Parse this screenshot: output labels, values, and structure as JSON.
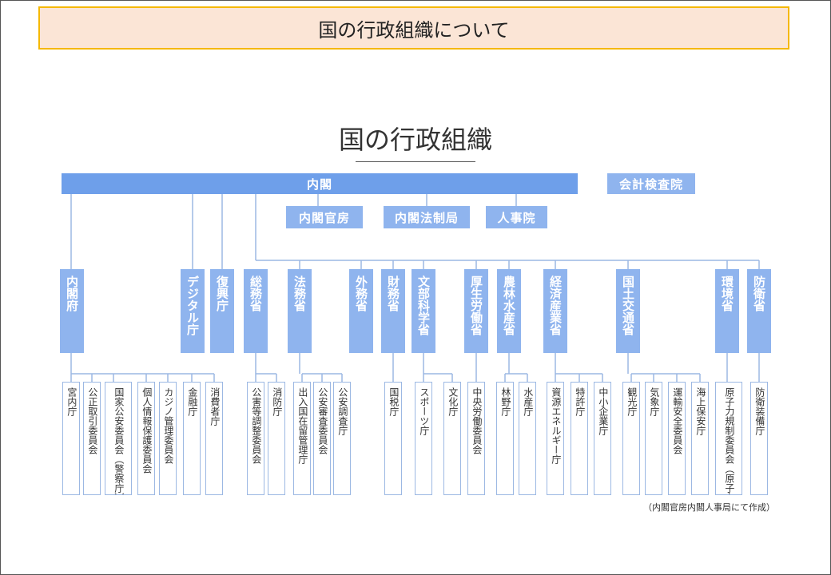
{
  "slide_title": "国の行政組織について",
  "diagram_title": "国の行政組織",
  "top": {
    "cabinet": "内閣",
    "board_of_audit": "会計検査院"
  },
  "secretariats": [
    "内閣官房",
    "内閣法制局",
    "人事院"
  ],
  "ministries": [
    "内閣府",
    "デジタル庁",
    "復興庁",
    "総務省",
    "法務省",
    "外務省",
    "財務省",
    "文部科学省",
    "厚生労働省",
    "農林水産省",
    "経済産業省",
    "国土交通省",
    "環境省",
    "防衛省"
  ],
  "agencies": [
    "宮内庁",
    "公正取引委員会",
    "国家公安委員会（警察庁）",
    "個人情報保護委員会",
    "カジノ管理委員会",
    "金融庁",
    "消費者庁",
    "公害等調整委員会",
    "消防庁",
    "出入国在留管理庁",
    "公安審査委員会",
    "公安調査庁",
    "国税庁",
    "スポーツ庁",
    "文化庁",
    "中央労働委員会",
    "林野庁",
    "水産庁",
    "資源エネルギー庁",
    "特許庁",
    "中小企業庁",
    "観光庁",
    "気象庁",
    "運輸安全委員会",
    "海上保安庁",
    "原子力規制委員会（原子力規制庁）",
    "防衛装備庁"
  ],
  "source": "（内閣官房内閣人事局にて作成）",
  "colors": {
    "header_fill": "#6e9fea",
    "box_fill": "#8fb4ee",
    "line": "#9cb8e3",
    "title_fill": "#fbe5d6",
    "title_border": "#f5b800"
  }
}
